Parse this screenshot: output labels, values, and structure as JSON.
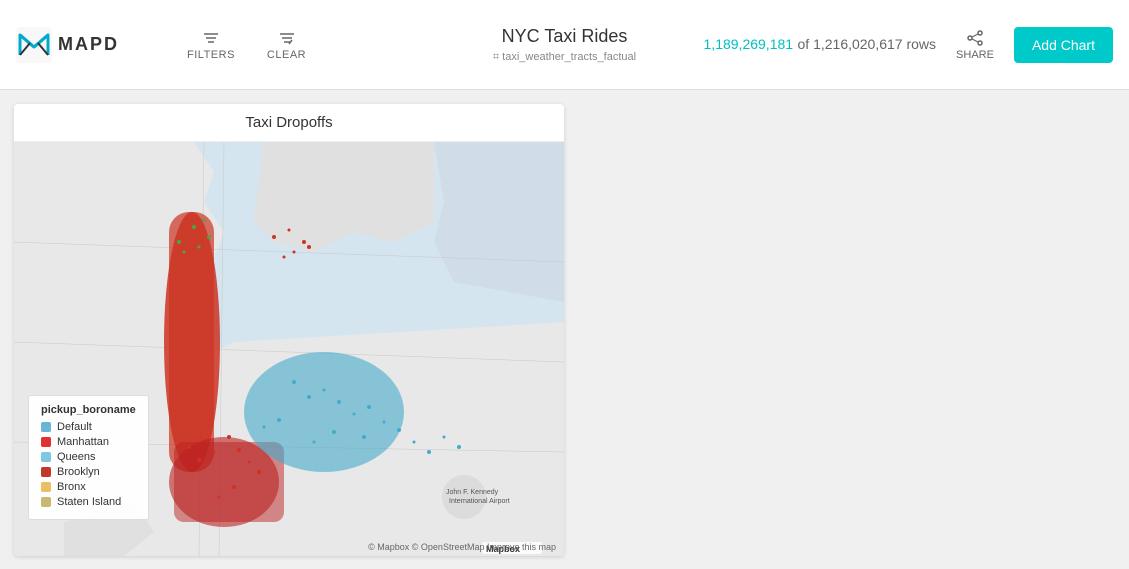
{
  "header": {
    "logo_text": "MAPD",
    "dashboard_title": "NYC Taxi Rides",
    "dashboard_subtitle": "taxi_weather_tracts_factual",
    "subtitle_icon": "⌗",
    "rows_highlight": "1,189,269,181",
    "rows_text": "of 1,216,020,617 rows",
    "filters_label": "FILTERS",
    "clear_label": "CLEAR",
    "share_label": "SHARE",
    "add_chart_label": "Add Chart"
  },
  "map_card": {
    "title": "Taxi Dropoffs"
  },
  "legend": {
    "title": "pickup_boroname",
    "items": [
      {
        "label": "Default",
        "color": "#6ab4d4"
      },
      {
        "label": "Manhattan",
        "color": "#e03030"
      },
      {
        "label": "Queens",
        "color": "#7ec8e3"
      },
      {
        "label": "Brooklyn",
        "color": "#c0392b"
      },
      {
        "label": "Bronx",
        "color": "#e8c060"
      },
      {
        "label": "Staten Island",
        "color": "#c8b870"
      }
    ]
  },
  "map_attribution": {
    "mapbox": "Mapbox",
    "osm": "© Mapbox   © OpenStreetMap   Improve this map"
  }
}
